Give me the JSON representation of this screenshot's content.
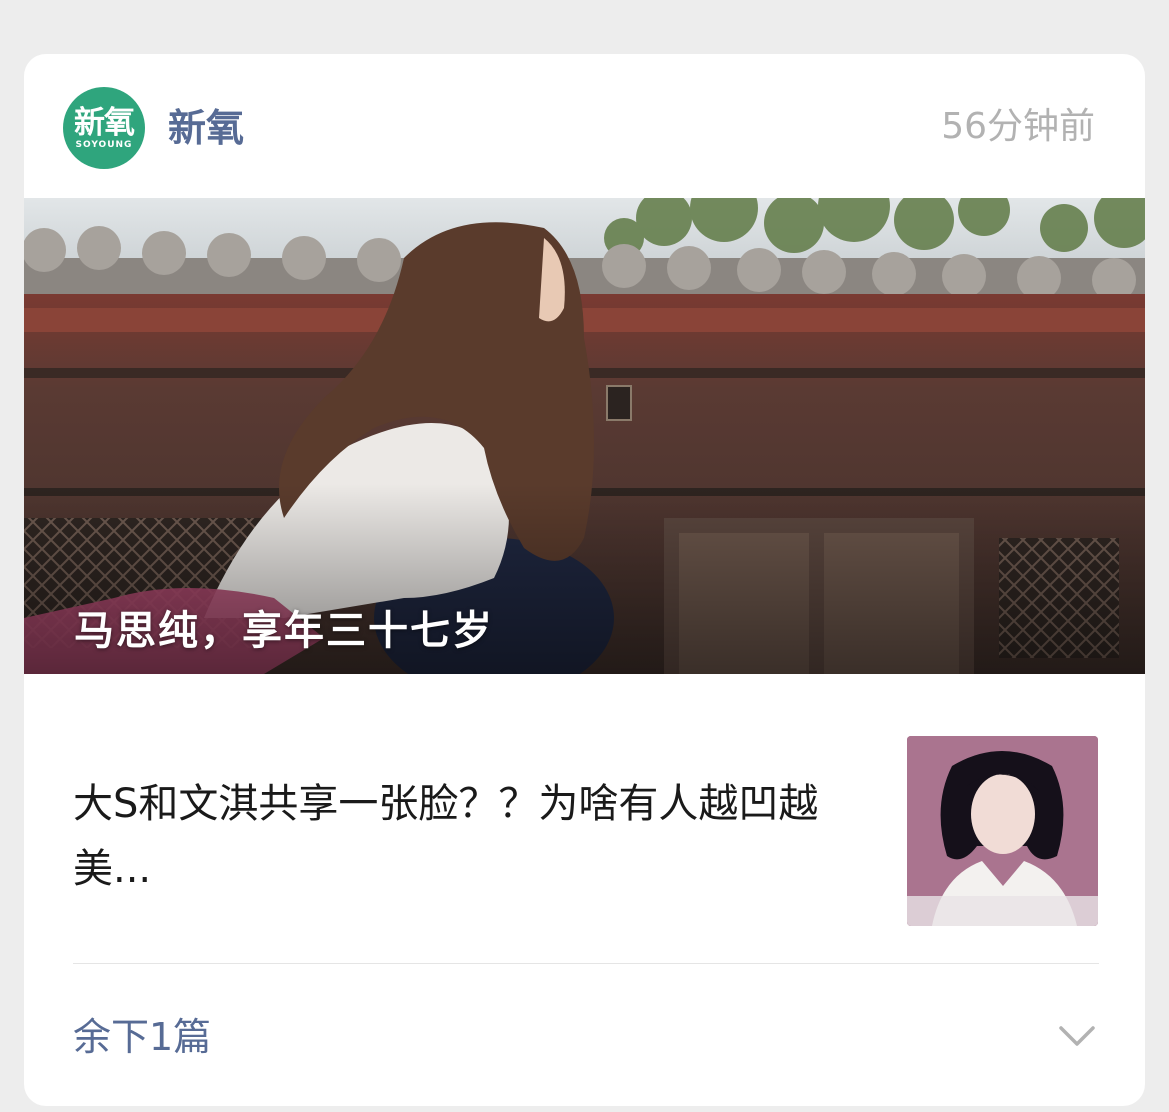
{
  "account": {
    "name": "新氧",
    "time": "56分钟前",
    "logo": {
      "main": "新氧",
      "sub": "SOYOUNG",
      "color": "#2fa57d"
    }
  },
  "hero": {
    "caption": "马思纯，享年三十七岁"
  },
  "article": {
    "title": "大S和文淇共享一张脸？？为啥有人越凹越美..."
  },
  "footer": {
    "more_label": "余下1篇",
    "icon": "chevron-down-icon"
  },
  "colors": {
    "link": "#576b95",
    "meta": "#b2b2b2",
    "text": "#1a1a1a",
    "background": "#ededed"
  }
}
